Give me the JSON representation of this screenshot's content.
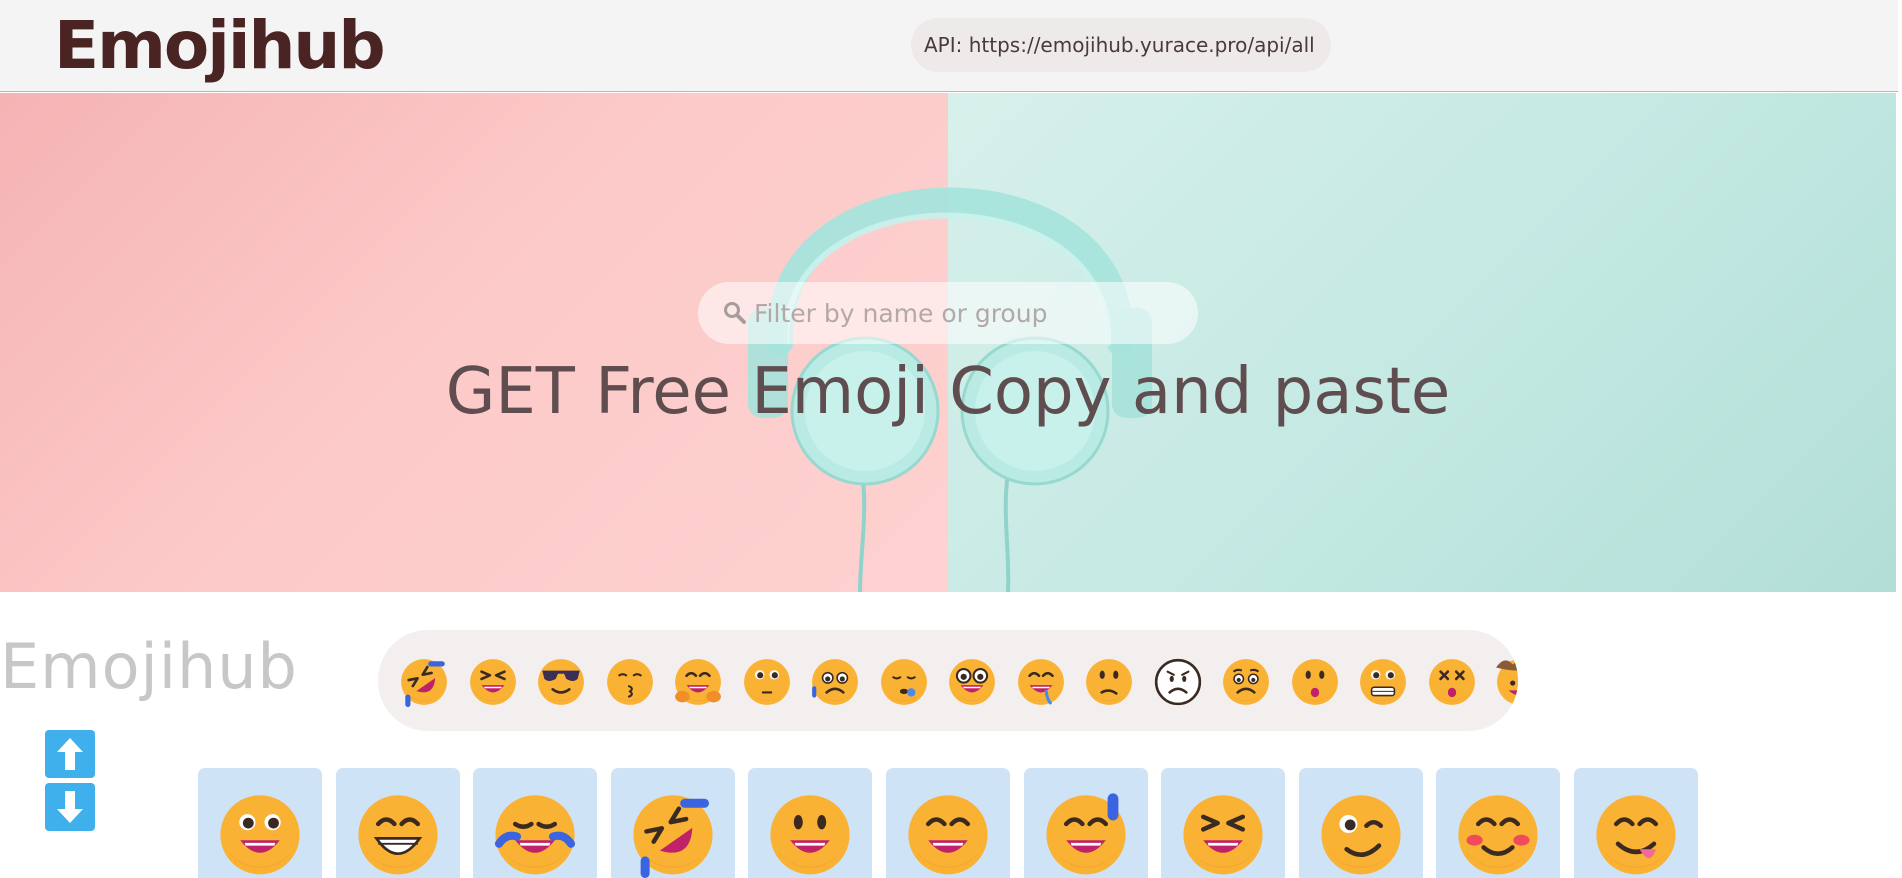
{
  "header": {
    "logo": "Emojihub",
    "api_label": "API: https://emojihub.yurace.pro/api/all"
  },
  "hero": {
    "search_placeholder": "Filter by name or group",
    "title": "GET Free Emoji Copy and paste"
  },
  "section": {
    "brand_faded": "Emojihub"
  },
  "strip_emojis": [
    "rofl",
    "squinting-grin",
    "sunglasses",
    "kissing",
    "hugging",
    "flushed",
    "pleading-sweat",
    "sleepy",
    "nerd",
    "drooling",
    "confused",
    "frowning-outline",
    "worried",
    "anguished",
    "grimacing",
    "dizzy",
    "cowboy-partial"
  ],
  "cards": [
    "grinning-face",
    "beaming-face",
    "tears-of-joy",
    "rofl",
    "grinning-big-eyes",
    "grinning-smiling-eyes",
    "grinning-sweat",
    "squinting-grin",
    "winking",
    "smiling-blush",
    "yum"
  ],
  "colors": {
    "accent": "#3fb0ec",
    "emoji_yellow": "#f9b233",
    "card_bg": "#cfe3f6"
  }
}
